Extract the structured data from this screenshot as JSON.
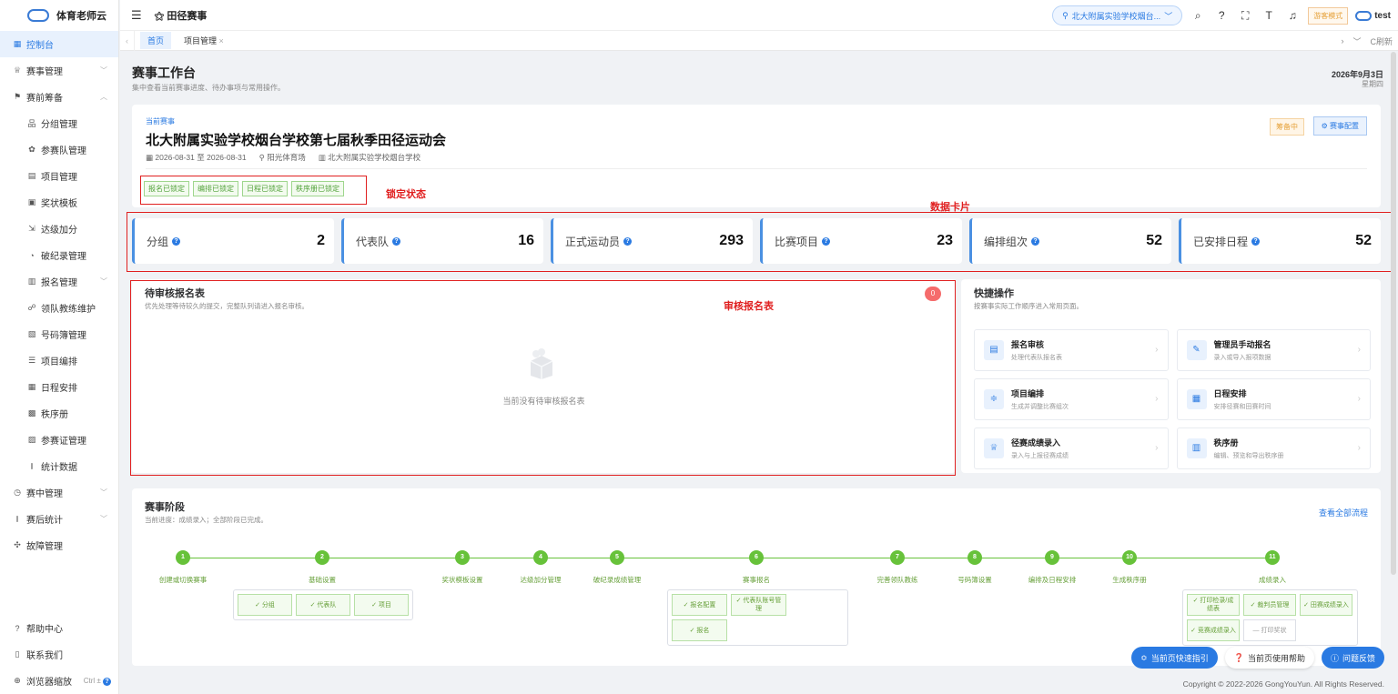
{
  "app": {
    "name": "体育老师云"
  },
  "sidebar": {
    "items": [
      {
        "icon": "grid-icon",
        "glyph": "▦",
        "label": "控制台",
        "level": 0,
        "active": true,
        "arrow": ""
      },
      {
        "icon": "trophy-icon",
        "glyph": "♕",
        "label": "赛事管理",
        "level": 0,
        "active": false,
        "arrow": "﹀"
      },
      {
        "icon": "flag-icon",
        "glyph": "⚑",
        "label": "赛前筹备",
        "level": 0,
        "active": false,
        "arrow": "︿"
      },
      {
        "icon": "org-icon",
        "glyph": "品",
        "label": "分组管理",
        "level": 1,
        "active": false,
        "arrow": ""
      },
      {
        "icon": "team-icon",
        "glyph": "✿",
        "label": "参赛队管理",
        "level": 1,
        "active": false,
        "arrow": ""
      },
      {
        "icon": "doc-icon",
        "glyph": "▤",
        "label": "项目管理",
        "level": 1,
        "active": false,
        "arrow": ""
      },
      {
        "icon": "certificate-icon",
        "glyph": "▣",
        "label": "奖状模板",
        "level": 1,
        "active": false,
        "arrow": ""
      },
      {
        "icon": "plus-score-icon",
        "glyph": "⇲",
        "label": "达级加分",
        "level": 1,
        "active": false,
        "arrow": ""
      },
      {
        "icon": "record-icon",
        "glyph": "◔",
        "label": "破纪录管理",
        "level": 1,
        "active": false,
        "arrow": ""
      },
      {
        "icon": "form-icon",
        "glyph": "▥",
        "label": "报名管理",
        "level": 1,
        "active": false,
        "arrow": "﹀"
      },
      {
        "icon": "coach-icon",
        "glyph": "☍",
        "label": "领队教练维护",
        "level": 1,
        "active": false,
        "arrow": ""
      },
      {
        "icon": "book-icon",
        "glyph": "▧",
        "label": "号码簿管理",
        "level": 1,
        "active": false,
        "arrow": ""
      },
      {
        "icon": "list-icon",
        "glyph": "☰",
        "label": "项目编排",
        "level": 1,
        "active": false,
        "arrow": ""
      },
      {
        "icon": "calendar-icon",
        "glyph": "▦",
        "label": "日程安排",
        "level": 1,
        "active": false,
        "arrow": ""
      },
      {
        "icon": "table-icon",
        "glyph": "▩",
        "label": "秩序册",
        "level": 1,
        "active": false,
        "arrow": ""
      },
      {
        "icon": "badge-icon",
        "glyph": "▨",
        "label": "参赛证管理",
        "level": 1,
        "active": false,
        "arrow": ""
      },
      {
        "icon": "chart-icon",
        "glyph": "⫾",
        "label": "统计数据",
        "level": 1,
        "active": false,
        "arrow": ""
      },
      {
        "icon": "timer-icon",
        "glyph": "◷",
        "label": "赛中管理",
        "level": 0,
        "active": false,
        "arrow": "﹀"
      },
      {
        "icon": "stats-icon",
        "glyph": "⫾",
        "label": "赛后统计",
        "level": 0,
        "active": false,
        "arrow": "﹀"
      },
      {
        "icon": "fault-icon",
        "glyph": "✣",
        "label": "故障管理",
        "level": 0,
        "active": false,
        "arrow": ""
      }
    ],
    "bottom": {
      "help": "帮助中心",
      "contact": "联系我们",
      "zoom": "浏览器缩放",
      "zoom_key": "Ctrl ±"
    }
  },
  "topbar": {
    "title": "田径赛事",
    "school": "北大附属实验学校烟台...",
    "mode": "游客模式",
    "user": "test"
  },
  "tabs": {
    "items": [
      "首页",
      "项目管理"
    ],
    "close": "×",
    "refresh": "C刷新"
  },
  "header": {
    "title": "赛事工作台",
    "subtitle": "集中查看当前赛事进度、待办事项与常用操作。",
    "date": "2026年9月3日",
    "weekday": "星期四"
  },
  "event": {
    "label": "当前赛事",
    "name": "北大附属实验学校烟台学校第七届秋季田径运动会",
    "dates": "2026-08-31 至 2026-08-31",
    "venue": "阳光体育场",
    "org": "北大附属实验学校烟台学校",
    "status": "筹备中",
    "config_btn": "赛事配置",
    "locks": [
      "报名已锁定",
      "编排已锁定",
      "日程已锁定",
      "秩序册已锁定"
    ]
  },
  "annotations": {
    "lock": "锁定状态",
    "cards": "数据卡片",
    "review": "审核报名表"
  },
  "stats": [
    {
      "label": "分组",
      "value": "2"
    },
    {
      "label": "代表队",
      "value": "16"
    },
    {
      "label": "正式运动员",
      "value": "293"
    },
    {
      "label": "比赛项目",
      "value": "23"
    },
    {
      "label": "编排组次",
      "value": "52"
    },
    {
      "label": "已安排日程",
      "value": "52"
    }
  ],
  "pending": {
    "title": "待审核报名表",
    "subtitle": "优先处理等待较久的提交，完整队列请进入报名审核。",
    "count": "0",
    "empty": "当前没有待审核报名表"
  },
  "quick": {
    "title": "快捷操作",
    "subtitle": "按赛事实际工作顺序进入常用页面。",
    "items": [
      {
        "icon": "review-icon",
        "glyph": "▤",
        "name": "报名审核",
        "desc": "处理代表队报名表"
      },
      {
        "icon": "edit-icon",
        "glyph": "✎",
        "name": "管理员手动报名",
        "desc": "录入或导入报项数据"
      },
      {
        "icon": "arrange-icon",
        "glyph": "≑",
        "name": "项目编排",
        "desc": "生成并调整比赛组次"
      },
      {
        "icon": "schedule-icon",
        "glyph": "▦",
        "name": "日程安排",
        "desc": "安排径赛和田赛时间"
      },
      {
        "icon": "cup-icon",
        "glyph": "♕",
        "name": "径赛成绩录入",
        "desc": "录入与上报径赛成绩"
      },
      {
        "icon": "booklet-icon",
        "glyph": "▥",
        "name": "秩序册",
        "desc": "编辑、预览和导出秩序册"
      }
    ]
  },
  "stages": {
    "title": "赛事阶段",
    "subtitle": "当前进度：成绩录入；全部阶段已完成。",
    "link": "查看全部流程",
    "steps": [
      "创建或切换赛事",
      "基础设置",
      "奖状模板设置",
      "达级加分管理",
      "破纪录成绩管理",
      "赛事报名",
      "完善领队教练",
      "号码簿设置",
      "编排及日程安排",
      "生成秩序册",
      "成绩录入"
    ],
    "groups": {
      "basic": [
        {
          "text": "✓ 分组",
          "done": true
        },
        {
          "text": "✓ 代表队",
          "done": true
        },
        {
          "text": "✓ 项目",
          "done": true
        }
      ],
      "signup": [
        {
          "text": "✓ 报名配置",
          "done": true
        },
        {
          "text": "✓ 代表队账号管理",
          "done": true
        },
        {
          "text": "✓ 报名",
          "done": true
        }
      ],
      "score": [
        {
          "text": "✓ 打印检录/成绩表",
          "done": true
        },
        {
          "text": "✓ 裁判员管理",
          "done": true
        },
        {
          "text": "✓ 田赛成绩录入",
          "done": true
        },
        {
          "text": "✓ 竞赛成绩录入",
          "done": true
        },
        {
          "text": "— 打印奖状",
          "done": false
        }
      ]
    }
  },
  "float": {
    "guide": "当前页快速指引",
    "help": "当前页使用帮助",
    "feedback": "问题反馈"
  },
  "footer": {
    "copyright": "Copyright © 2022-2026 GongYouYun. All Rights Reserved."
  },
  "colors": {
    "primary": "#2a7ae2",
    "success": "#67c23a",
    "danger": "#e02020",
    "warning": "#e6a23c"
  }
}
